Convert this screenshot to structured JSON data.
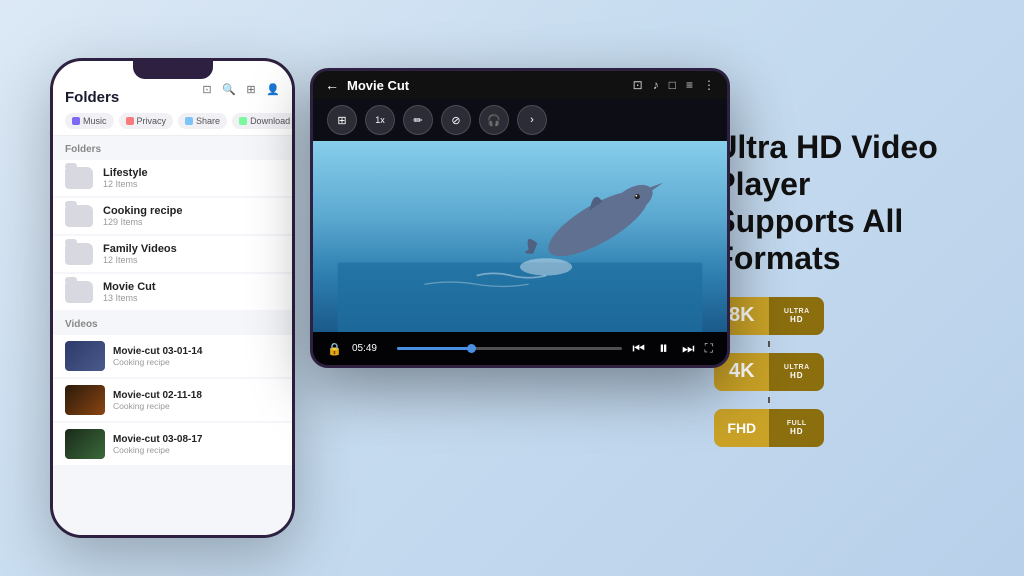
{
  "headline": {
    "line1": "Ultra HD Video Player",
    "line2": "Supports All Formats"
  },
  "phone": {
    "title": "Folders",
    "tabs": [
      "Music",
      "Privacy",
      "Share",
      "Download"
    ],
    "folders_section": "Folders",
    "folders": [
      {
        "name": "Lifestyle",
        "count": "12 Items"
      },
      {
        "name": "Cooking recipe",
        "count": "129 Items"
      },
      {
        "name": "Family Videos",
        "count": "12 Items"
      },
      {
        "name": "Movie Cut",
        "count": "13 Items"
      }
    ],
    "videos_section": "Videos",
    "videos": [
      {
        "name": "Movie-cut 03-01-14",
        "sub": "Cooking recipe"
      },
      {
        "name": "Movie-cut 02-11-18",
        "sub": "Cooking recipe"
      },
      {
        "name": "Movie-cut 03-08-17",
        "sub": "Cooking recipe"
      }
    ]
  },
  "tablet": {
    "title": "Movie Cut",
    "time": "05:49",
    "controls": [
      "⊞",
      "1x",
      "✏",
      "⊘",
      "🎧",
      ">"
    ]
  },
  "badges": [
    {
      "main": "8K",
      "top": "ULTRA",
      "bot": "HD"
    },
    {
      "main": "4K",
      "top": "ULTRA",
      "bot": "HD"
    },
    {
      "main": "FHD",
      "top": "FULL",
      "bot": "HD"
    }
  ]
}
